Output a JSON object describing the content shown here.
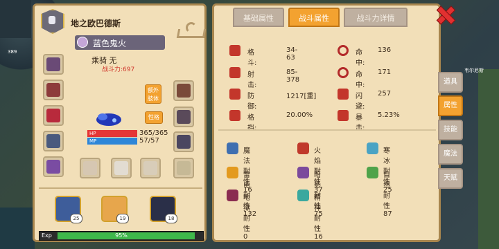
{
  "character": {
    "name": "地之欧巴德斯",
    "pet_name": "蓝色鬼火",
    "mount_text": "乘骑 无",
    "combat_power": "战斗力:697",
    "extra_body_label": "额外肢体",
    "trait_label": "性格",
    "hp_label": "HP",
    "hp_value": "365/365",
    "mp_label": "MP",
    "mp_value": "57/57",
    "hp_fraction": 1.0,
    "mp_fraction": 1.0
  },
  "party": [
    {
      "level": "25"
    },
    {
      "level": "19"
    },
    {
      "level": "18"
    }
  ],
  "exp": {
    "label": "Exp",
    "percent_text": "95%",
    "fraction": 0.95
  },
  "tabs": [
    {
      "label": "基础属性",
      "active": false
    },
    {
      "label": "战斗属性",
      "active": true
    },
    {
      "label": "战斗力详情",
      "active": false
    }
  ],
  "combat_stats": [
    {
      "name": "格斗:",
      "value": "34-63"
    },
    {
      "name": "命中:",
      "value": "136"
    },
    {
      "name": "射击:",
      "value": "85-378"
    },
    {
      "name": "命中:",
      "value": "171"
    },
    {
      "name": "防御:",
      "value": "1217[重]"
    },
    {
      "name": "闪避:",
      "value": "257"
    },
    {
      "name": "格挡:",
      "value": "20.00%"
    },
    {
      "name": "暴击:",
      "value": "5.23%"
    }
  ],
  "resistances": [
    {
      "label": "魔法耐性 16",
      "color": "#3f6fb0"
    },
    {
      "label": "火焰耐性 37",
      "color": "#c0392b"
    },
    {
      "label": "寒冰耐性 25",
      "color": "#4aa3c4"
    },
    {
      "label": "雷电耐性 132",
      "color": "#e39a1e"
    },
    {
      "label": "暗影耐性 75",
      "color": "#7b4a9c"
    },
    {
      "label": "自然耐性 87",
      "color": "#4fa34a"
    },
    {
      "label": "地狱耐性 0",
      "color": "#8a2c50"
    },
    {
      "label": "精神耐性 16",
      "color": "#3aa89e"
    }
  ],
  "side_menu": [
    {
      "label": "道具",
      "active": false
    },
    {
      "label": "属性",
      "active": true
    },
    {
      "label": "技能",
      "active": false
    },
    {
      "label": "魔法",
      "active": false
    },
    {
      "label": "天赋",
      "active": false
    }
  ],
  "hud": {
    "score": "389",
    "npc_name": "韦尔尼斯"
  },
  "colors": {
    "panel": "#f2dfb8",
    "accent": "#f3a230",
    "red": "#c3362b"
  }
}
